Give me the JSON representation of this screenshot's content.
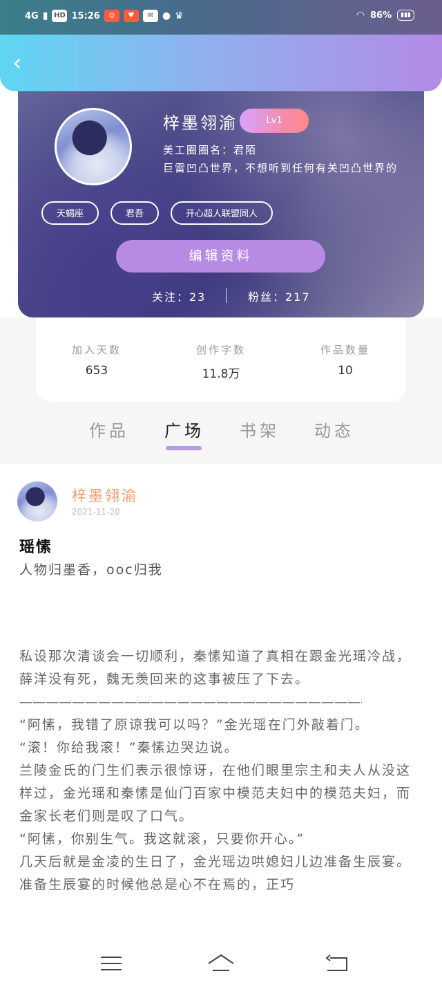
{
  "status_bar": {
    "network": "4G",
    "hd": "HD",
    "time": "15:26",
    "battery_text": "86%"
  },
  "header": {
    "back_label": "‹"
  },
  "profile": {
    "nickname": "梓墨翎渝",
    "level": "Lv1",
    "circle_name": "美工圈圈名：君陌",
    "bio": "巨雷凹凸世界，不想听到任何有关凹凸世界的",
    "tags": [
      "天蝎座",
      "君吾",
      "开心超人联盟同人"
    ],
    "edit_label": "编辑资料",
    "follow_text": "关注：23",
    "fans_text": "粉丝：217"
  },
  "stats": [
    {
      "label": "加入天数",
      "value": "653"
    },
    {
      "label": "创作字数",
      "value": "11.8万"
    },
    {
      "label": "作品数量",
      "value": "10"
    }
  ],
  "tabs": [
    {
      "label": "作品",
      "active": false
    },
    {
      "label": "广场",
      "active": true
    },
    {
      "label": "书架",
      "active": false
    },
    {
      "label": "动态",
      "active": false
    }
  ],
  "post": {
    "author": "梓墨翎渝",
    "date": "2021-11-20",
    "title": "瑶愫",
    "subtitle": "人物归墨香，ooc归我",
    "body": [
      "私设那次清谈会一切顺利，秦愫知道了真相在跟金光瑶冷战，薛洋没有死，魏无羡回来的这事被压了下去。",
      "———————————————————————————",
      "“阿愫，我错了原谅我可以吗？”金光瑶在门外敲着门。",
      "“滚！你给我滚！”秦愫边哭边说。",
      "兰陵金氏的门生们表示很惊讶，在他们眼里宗主和夫人从没这样过，金光瑶和秦愫是仙门百家中模范夫妇中的模范夫妇，而金家长老们则是叹了口气。",
      "“阿愫，你别生气。我这就滚，只要你开心。”",
      "几天后就是金凌的生日了，金光瑶边哄媳妇儿边准备生辰宴。准备生辰宴的时候他总是心不在焉的，正巧"
    ]
  },
  "colors": {
    "header_start": "#5fd6f2",
    "header_end": "#b28be6",
    "accent": "#b78ae3",
    "author": "#f09a6a"
  }
}
